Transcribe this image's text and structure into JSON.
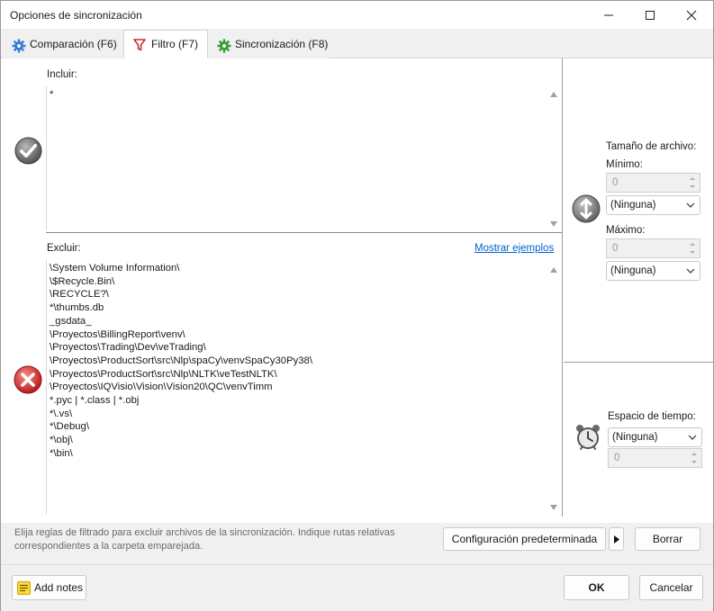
{
  "window": {
    "title": "Opciones de sincronización"
  },
  "tabs": [
    {
      "label": "Comparación (F6)",
      "icon": "gear-blue-icon"
    },
    {
      "label": "Filtro (F7)",
      "icon": "filter-red-icon"
    },
    {
      "label": "Sincronización (F8)",
      "icon": "gear-green-icon"
    }
  ],
  "include": {
    "label": "Incluir:",
    "text": "*"
  },
  "exclude": {
    "label": "Excluir:",
    "examples_link": "Mostrar ejemplos",
    "text": "\\System Volume Information\\\n\\$Recycle.Bin\\\n\\RECYCLE?\\\n*\\thumbs.db\n_gsdata_\n\\Proyectos\\BillingReport\\venv\\\n\\Proyectos\\Trading\\Dev\\veTrading\\\n\\Proyectos\\ProductSort\\src\\Nlp\\spaCy\\venvSpaCy30Py38\\\n\\Proyectos\\ProductSort\\src\\Nlp\\NLTK\\veTestNLTK\\\n\\Proyectos\\IQVisio\\Vision\\Vision20\\QC\\venvTimm\n*.pyc | *.class | *.obj\n*\\.vs\\\n*\\Debug\\\n*\\obj\\\n*\\bin\\"
  },
  "file_size": {
    "label": "Tamaño de archivo:",
    "min_label": "Mínimo:",
    "min_value": "0",
    "min_unit": "(Ninguna)",
    "max_label": "Máximo:",
    "max_value": "0",
    "max_unit": "(Ninguna)"
  },
  "time_span": {
    "label": "Espacio de tiempo:",
    "unit": "(Ninguna)",
    "value": "0"
  },
  "hint": "Elija reglas de filtrado para excluir archivos de la sincronización. Indique rutas relativas correspondientes a la carpeta emparejada.",
  "buttons": {
    "default_config": "Configuración predeterminada",
    "clear": "Borrar",
    "add_notes": "Add notes",
    "ok": "OK",
    "cancel": "Cancelar"
  },
  "colors": {
    "accent_link": "#0064c8",
    "include_icon": "#7a7a7a",
    "exclude_icon": "#d9302c"
  }
}
